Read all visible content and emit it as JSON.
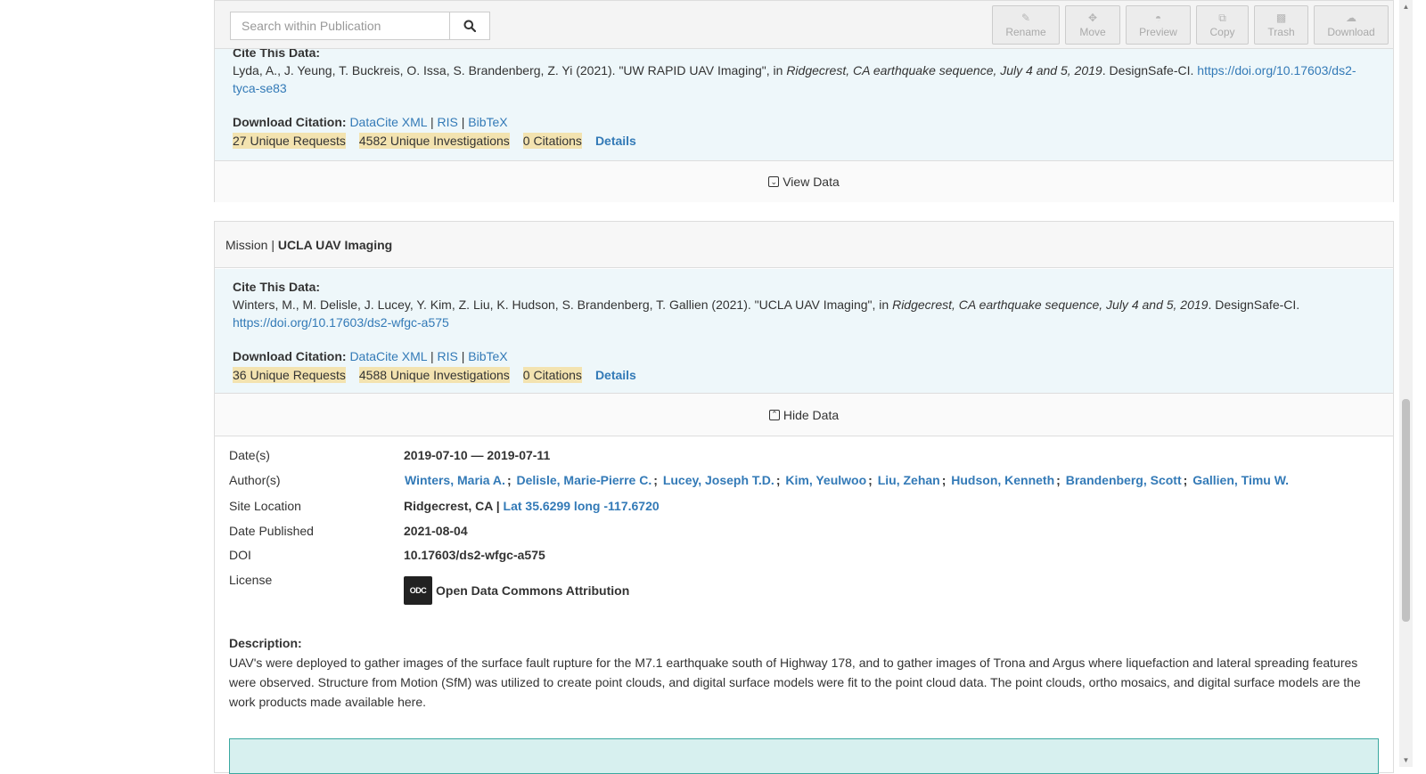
{
  "toolbar": {
    "search_placeholder": "Search within Publication",
    "buttons": [
      {
        "label": "Rename",
        "icon": "pencil-icon"
      },
      {
        "label": "Move",
        "icon": "move-icon"
      },
      {
        "label": "Preview",
        "icon": "binoculars-icon"
      },
      {
        "label": "Copy",
        "icon": "copy-icon"
      },
      {
        "label": "Trash",
        "icon": "trash-icon"
      },
      {
        "label": "Download",
        "icon": "cloud-download-icon"
      }
    ]
  },
  "panel1": {
    "cite_label": "Cite This Data:",
    "citation_authors": "Lyda, A., J. Yeung, T. Buckreis, O. Issa, S. Brandenberg, Z. Yi (2021). \"UW RAPID UAV Imaging\", in ",
    "citation_project": "Ridgecrest, CA earthquake sequence, July 4 and 5, 2019",
    "citation_tail": ". DesignSafe-CI. ",
    "doi_url": "https://doi.org/10.17603/ds2-tyca-se83",
    "download_label": "Download Citation:",
    "download_links": [
      "DataCite XML",
      "RIS",
      "BibTeX"
    ],
    "metrics": {
      "requests": "27 Unique Requests",
      "investigations": "4582 Unique Investigations",
      "citations": "0 Citations",
      "details": "Details"
    },
    "toggle_label": "View Data"
  },
  "panel2": {
    "mission_prefix": "Mission |",
    "mission_title": "UCLA UAV Imaging",
    "cite_label": "Cite This Data:",
    "citation_authors": "Winters, M., M. Delisle, J. Lucey, Y. Kim, Z. Liu, K. Hudson, S. Brandenberg, T. Gallien (2021). \"UCLA UAV Imaging\", in ",
    "citation_project": "Ridgecrest, CA earthquake sequence, July 4 and 5, 2019",
    "citation_tail": ". DesignSafe-CI.",
    "doi_url": "https://doi.org/10.17603/ds2-wfgc-a575",
    "download_label": "Download Citation:",
    "download_links": [
      "DataCite XML",
      "RIS",
      "BibTeX"
    ],
    "metrics": {
      "requests": "36 Unique Requests",
      "investigations": "4588 Unique Investigations",
      "citations": "0 Citations",
      "details": "Details"
    },
    "toggle_label": "Hide Data",
    "meta": {
      "dates_key": "Date(s)",
      "dates_val": "2019-07-10 — 2019-07-11",
      "authors_key": "Author(s)",
      "authors": [
        "Winters, Maria A.",
        "Delisle, Marie-Pierre C.",
        "Lucey, Joseph T.D.",
        "Kim, Yeulwoo",
        "Liu, Zehan",
        "Hudson, Kenneth",
        "Brandenberg, Scott",
        "Gallien, Timu W."
      ],
      "site_key": "Site Location",
      "site_val": "Ridgecrest, CA |",
      "site_coords": "Lat 35.6299 long -117.6720",
      "published_key": "Date Published",
      "published_val": "2021-08-04",
      "doi_key": "DOI",
      "doi_val": "10.17603/ds2-wfgc-a575",
      "license_key": "License",
      "license_badge": "ODC",
      "license_val": "Open Data Commons Attribution"
    },
    "description_label": "Description:",
    "description": "UAV's were deployed to gather images of the surface fault rupture for the M7.1 earthquake south of Highway 178, and to gather images of Trona and Argus where liquefaction and lateral spreading features were observed. Structure from Motion (SfM) was utilized to create point clouds, and digital surface models were fit to the point cloud data. The point clouds, ortho mosaics, and digital surface models are the work products made available here."
  }
}
